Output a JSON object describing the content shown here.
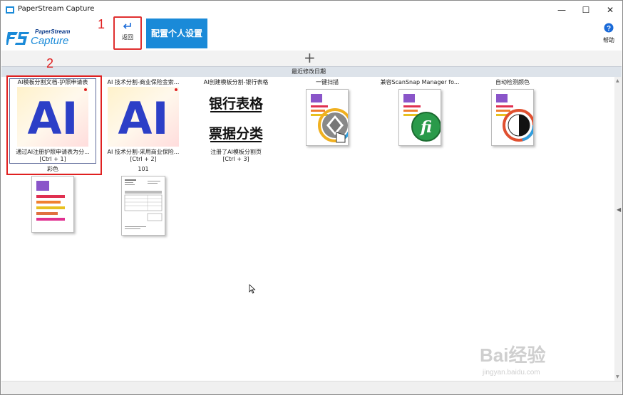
{
  "window": {
    "title": "PaperStream Capture"
  },
  "logo": {
    "line1": "PaperStream",
    "line2": "Capture"
  },
  "toolbar": {
    "back_label": "返回",
    "profile_label": "配置个人设置",
    "help_label": "帮助"
  },
  "annotations": [
    "1",
    "2"
  ],
  "sortbar": {
    "label": "最近修改日期"
  },
  "cards": [
    {
      "title": "AI模板分割文档-护照申请表",
      "desc": "通过AI注册护照申请表为分...",
      "shortcut": "[Ctrl + 1]",
      "thumb_text": "AI"
    },
    {
      "title": "AI 技术分割-商业保险金索...",
      "desc": "AI 技术分割-采用商业保险...",
      "shortcut": "[Ctrl + 2]",
      "thumb_text": "AI"
    },
    {
      "title": "AI创建模板分割-银行表格",
      "desc": "注册了AI模板分割页",
      "shortcut": "[Ctrl + 3]",
      "thumb_line1": "银行表格",
      "thumb_line2": "票据分类"
    },
    {
      "title": "一键扫描",
      "icon": "one-touch-scan-icon"
    },
    {
      "title": "兼容ScanSnap Manager fo...",
      "icon": "scansnap-fi-icon"
    },
    {
      "title": "自动检测颜色",
      "icon": "auto-color-icon"
    },
    {
      "title": "彩色",
      "icon": "color-document-icon"
    },
    {
      "title": "101",
      "icon": "invoice-document-icon"
    }
  ],
  "watermark": {
    "line1": "Bai经验",
    "line2": "jingyan.baidu.com"
  },
  "colors": {
    "accent": "#1a8ad8",
    "annotation": "#e02020",
    "ai_blue": "#2c3fc7"
  }
}
